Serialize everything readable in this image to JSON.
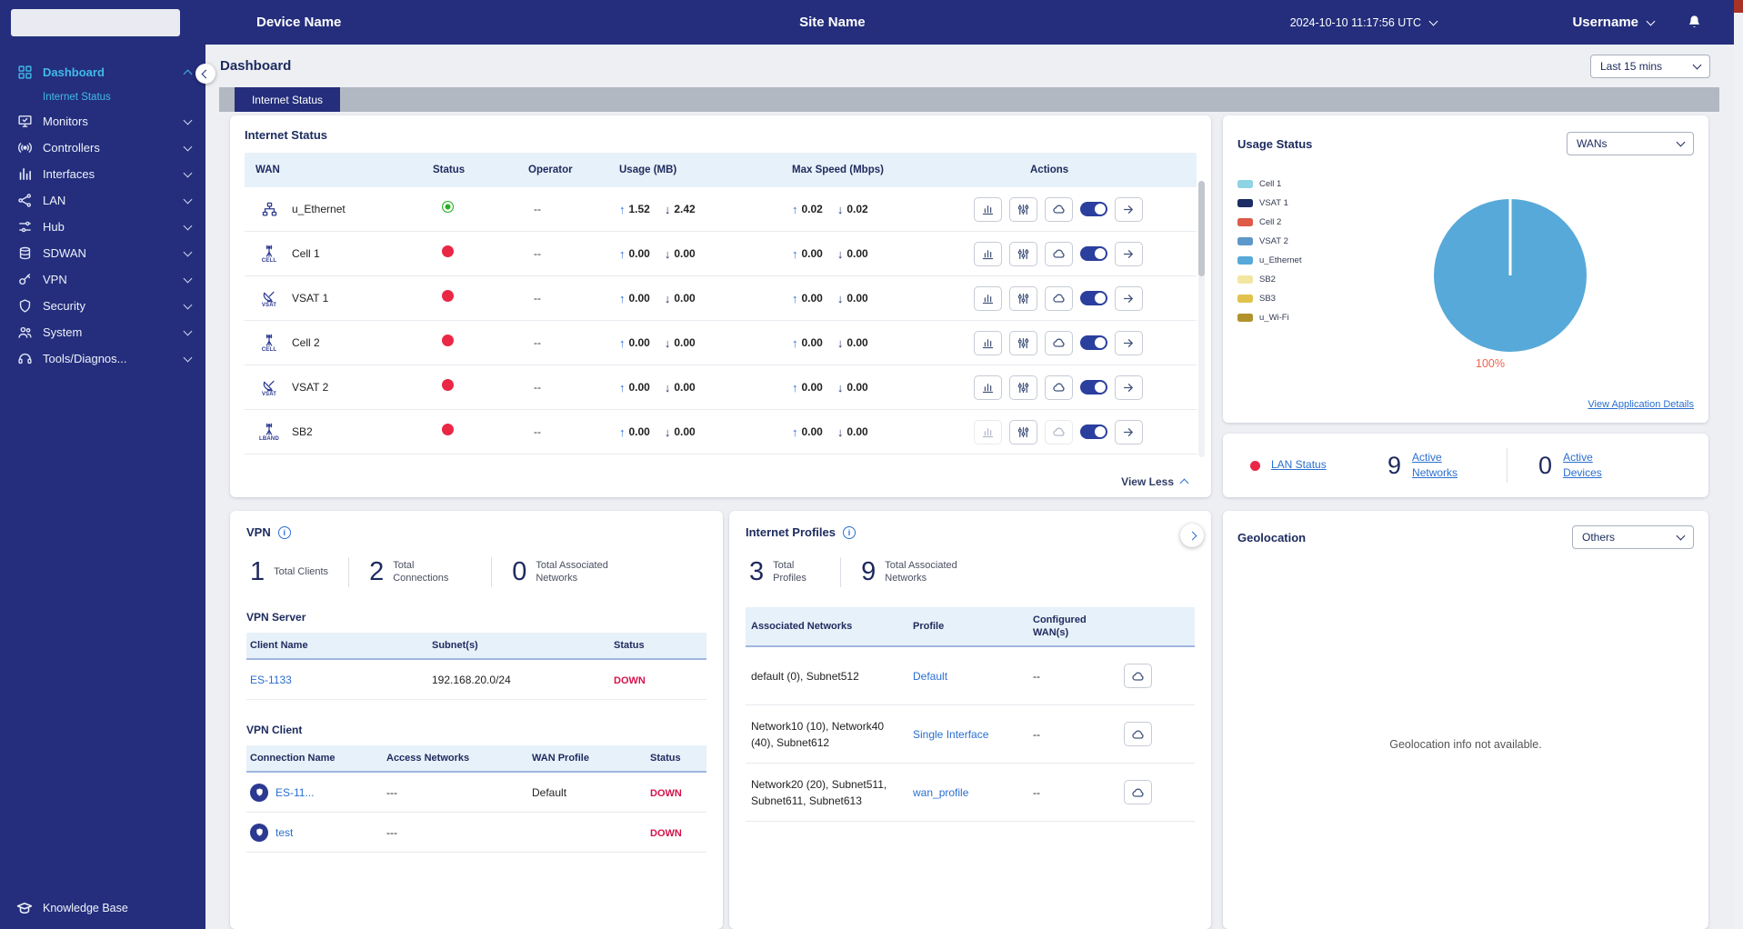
{
  "topbar": {
    "device_name": "Device Name",
    "site_name": "Site Name",
    "datetime": "2024-10-10 11:17:56 UTC",
    "username": "Username"
  },
  "sidebar": {
    "items": [
      {
        "label": "Dashboard"
      },
      {
        "label": "Monitors"
      },
      {
        "label": "Controllers"
      },
      {
        "label": "Interfaces"
      },
      {
        "label": "LAN"
      },
      {
        "label": "Hub"
      },
      {
        "label": "SDWAN"
      },
      {
        "label": "VPN"
      },
      {
        "label": "Security"
      },
      {
        "label": "System"
      },
      {
        "label": "Tools/Diagnos..."
      }
    ],
    "active_sub_item": "Internet Status",
    "knowledge_base": "Knowledge Base"
  },
  "page": {
    "title": "Dashboard",
    "time_filter": "Last 15 mins",
    "tab": "Internet Status"
  },
  "internet_status": {
    "title": "Internet Status",
    "columns": [
      "WAN",
      "Status",
      "Operator",
      "Usage (MB)",
      "Max Speed (Mbps)",
      "Actions"
    ],
    "rows": [
      {
        "wan": "u_Ethernet",
        "type_label": "",
        "status": "up",
        "operator": "--",
        "usage_up": "1.52",
        "usage_down": "2.42",
        "speed_up": "0.02",
        "speed_down": "0.02"
      },
      {
        "wan": "Cell 1",
        "type_label": "CELL",
        "status": "down",
        "operator": "--",
        "usage_up": "0.00",
        "usage_down": "0.00",
        "speed_up": "0.00",
        "speed_down": "0.00"
      },
      {
        "wan": "VSAT 1",
        "type_label": "VSAT",
        "status": "down",
        "operator": "--",
        "usage_up": "0.00",
        "usage_down": "0.00",
        "speed_up": "0.00",
        "speed_down": "0.00"
      },
      {
        "wan": "Cell 2",
        "type_label": "CELL",
        "status": "down",
        "operator": "--",
        "usage_up": "0.00",
        "usage_down": "0.00",
        "speed_up": "0.00",
        "speed_down": "0.00"
      },
      {
        "wan": "VSAT 2",
        "type_label": "VSAT",
        "status": "down",
        "operator": "--",
        "usage_up": "0.00",
        "usage_down": "0.00",
        "speed_up": "0.00",
        "speed_down": "0.00"
      },
      {
        "wan": "SB2",
        "type_label": "LBAND",
        "status": "down",
        "operator": "--",
        "usage_up": "0.00",
        "usage_down": "0.00",
        "speed_up": "0.00",
        "speed_down": "0.00"
      }
    ],
    "view_less": "View Less"
  },
  "usage_status": {
    "title": "Usage Status",
    "filter": "WANs",
    "legend": [
      {
        "label": "Cell 1",
        "color": "#8ed4e4"
      },
      {
        "label": "VSAT 1",
        "color": "#1b2d64"
      },
      {
        "label": "Cell 2",
        "color": "#de5a49"
      },
      {
        "label": "VSAT 2",
        "color": "#5e97c9"
      },
      {
        "label": "u_Ethernet",
        "color": "#57a9d9"
      },
      {
        "label": "SB2",
        "color": "#f3e5a2"
      },
      {
        "label": "SB3",
        "color": "#e2c24c"
      },
      {
        "label": "u_Wi-Fi",
        "color": "#b2922d"
      }
    ],
    "pie_color": "#57a9d9",
    "pie_label": "100%",
    "details_link": "View Application Details"
  },
  "lan_status": {
    "label": "LAN Status",
    "networks_value": "9",
    "networks_label": "Active Networks",
    "devices_value": "0",
    "devices_label": "Active Devices"
  },
  "vpn": {
    "title": "VPN",
    "stats": [
      {
        "value": "1",
        "label": "Total Clients"
      },
      {
        "value": "2",
        "label": "Total Connections"
      },
      {
        "value": "0",
        "label": "Total Associated Networks"
      }
    ],
    "server": {
      "title": "VPN Server",
      "columns": [
        "Client Name",
        "Subnet(s)",
        "Status"
      ],
      "rows": [
        {
          "client_name": "ES-1133",
          "subnets": "192.168.20.0/24",
          "status": "DOWN"
        }
      ]
    },
    "client": {
      "title": "VPN Client",
      "columns": [
        "Connection Name",
        "Access Networks",
        "WAN Profile",
        "Status"
      ],
      "rows": [
        {
          "connection_name": "ES-11...",
          "access_networks": "---",
          "wan_profile": "Default",
          "status": "DOWN"
        },
        {
          "connection_name": "test",
          "access_networks": "---",
          "wan_profile": "",
          "status": "DOWN"
        }
      ]
    }
  },
  "internet_profiles": {
    "title": "Internet Profiles",
    "stats": [
      {
        "value": "3",
        "label": "Total Profiles"
      },
      {
        "value": "9",
        "label": "Total Associated Networks"
      }
    ],
    "columns": [
      "Associated Networks",
      "Profile",
      "Configured WAN(s)"
    ],
    "rows": [
      {
        "networks": "default (0), Subnet512",
        "profile": "Default",
        "wans": "--"
      },
      {
        "networks": "Network10 (10), Network40 (40), Subnet612",
        "profile": "Single Interface",
        "wans": "--"
      },
      {
        "networks": "Network20 (20), Subnet511, Subnet611, Subnet613",
        "profile": "wan_profile",
        "wans": "--"
      }
    ]
  },
  "geolocation": {
    "title": "Geolocation",
    "filter": "Others",
    "message": "Geolocation info not available."
  },
  "chart_data": {
    "type": "pie",
    "title": "Usage Status",
    "labels": [
      "u_Ethernet"
    ],
    "values": [
      100
    ],
    "unit": "%",
    "legend_position": "left",
    "legend_entries": [
      "Cell 1",
      "VSAT 1",
      "Cell 2",
      "VSAT 2",
      "u_Ethernet",
      "SB2",
      "SB3",
      "u_Wi-Fi"
    ]
  }
}
